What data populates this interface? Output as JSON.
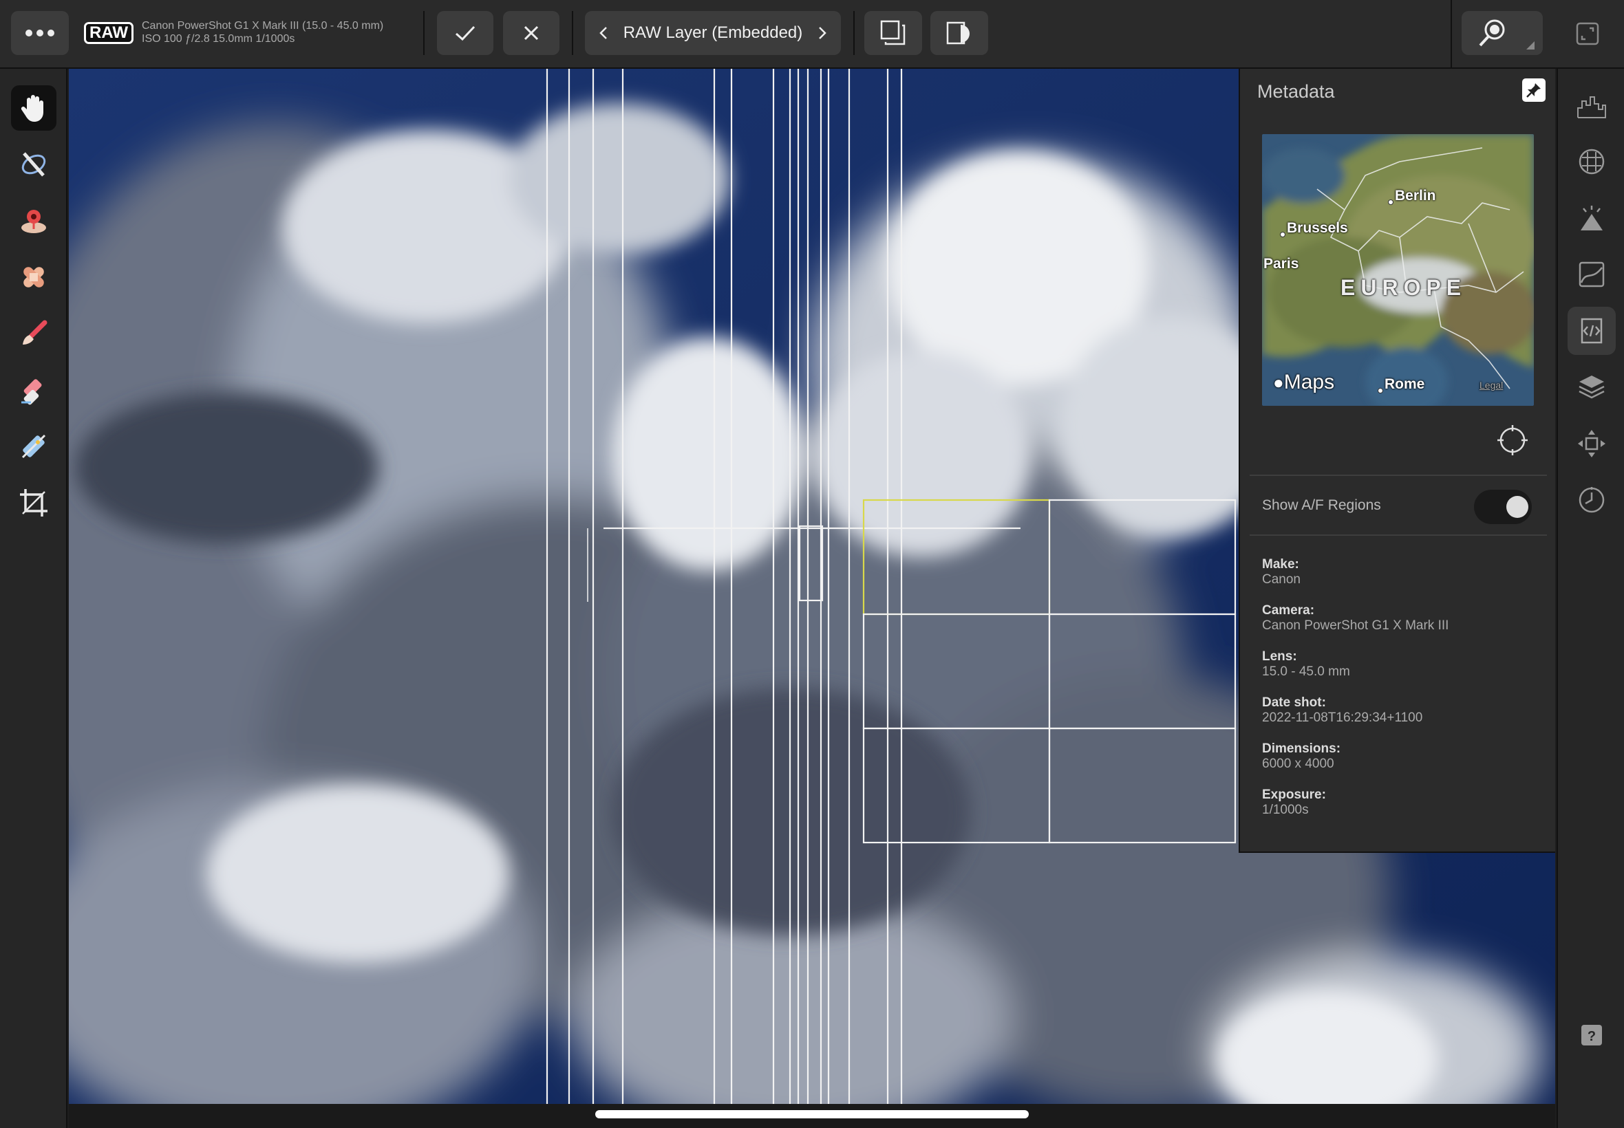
{
  "topbar": {
    "more_icon": "more-dots-icon",
    "raw_badge": "RAW",
    "camera_line1": "Canon PowerShot G1 X Mark III (15.0 - 45.0 mm)",
    "camera_line2": "ISO 100 ƒ/2.8 15.0mm 1/1000s",
    "confirm_icon": "checkmark-icon",
    "cancel_icon": "close-icon",
    "layer_label": "RAW Layer (Embedded)",
    "prev_icon": "chevron-left-icon",
    "next_icon": "chevron-right-icon"
  },
  "left_tools": [
    {
      "name": "hand-tool",
      "icon": "hand-icon",
      "active": true
    },
    {
      "name": "select-tool",
      "icon": "selection-brush-icon"
    },
    {
      "name": "red-eye-tool",
      "icon": "red-eye-icon"
    },
    {
      "name": "blemish-tool",
      "icon": "bandage-icon"
    },
    {
      "name": "brush-tool",
      "icon": "paint-brush-icon"
    },
    {
      "name": "erase-tool",
      "icon": "eraser-icon"
    },
    {
      "name": "gradient-tool",
      "icon": "gradient-icon"
    },
    {
      "name": "crop-tool",
      "icon": "crop-icon"
    }
  ],
  "right_tools": [
    {
      "name": "histogram-panel",
      "icon": "histogram-icon"
    },
    {
      "name": "focus-panel",
      "icon": "focus-grid-icon"
    },
    {
      "name": "clipping-panel",
      "icon": "clipping-icon"
    },
    {
      "name": "curves-panel",
      "icon": "curves-icon"
    },
    {
      "name": "metadata-panel",
      "icon": "code-icon",
      "active": true
    },
    {
      "name": "layers-panel",
      "icon": "layers-icon"
    },
    {
      "name": "transform-panel",
      "icon": "move-icon"
    },
    {
      "name": "history-panel",
      "icon": "history-clock-icon"
    },
    {
      "name": "help-button",
      "icon": "help-icon"
    }
  ],
  "panel": {
    "title": "Metadata",
    "map": {
      "labels": [
        "Berlin",
        "Brussels",
        "Paris",
        "EUROPE",
        "Rome",
        "Legal"
      ],
      "brand": "Maps"
    },
    "af_label": "Show A/F Regions",
    "af_on": true,
    "metadata": [
      {
        "key": "Make:",
        "value": "Canon"
      },
      {
        "key": "Camera:",
        "value": "Canon PowerShot G1 X Mark III"
      },
      {
        "key": "Lens:",
        "value": "15.0 - 45.0 mm"
      },
      {
        "key": "Date shot:",
        "value": "2022-11-08T16:29:34+1100"
      },
      {
        "key": "Dimensions:",
        "value": "6000 x 4000"
      },
      {
        "key": "Exposure:",
        "value": "1/1000s"
      }
    ]
  },
  "colors": {
    "accent_af": "#d8d84a",
    "sky": "#1b3570"
  }
}
